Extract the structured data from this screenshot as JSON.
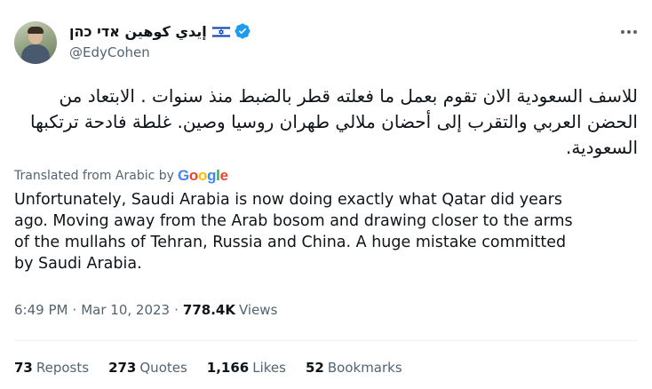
{
  "author": {
    "display_name": "إيدي كوهين אדי כהן",
    "handle": "@EdyCohen",
    "flag_icon": "israel-flag-icon",
    "verified_icon": "verified-badge-icon",
    "verified_color": "#1d9bf0"
  },
  "tweet": {
    "original_lines": [
      "للاسف السعودية الان تقوم بعمل ما فعلته قطر بالضبط منذ سنوات . الابتعاد من",
      "الحضن العربي والتقرب إلى أحضان ملالي طهران روسيا وصين. غلطة فادحة ترتكبها",
      "السعودية."
    ],
    "translated_label": "Translated from Arabic by",
    "translator": "Google",
    "translation_lines": [
      "Unfortunately, Saudi Arabia is now doing exactly what Qatar did years",
      "ago. Moving away from the Arab bosom and drawing closer to the arms",
      "of the mullahs of Tehran, Russia and China. A huge mistake committed",
      "by Saudi Arabia."
    ]
  },
  "meta": {
    "time": "6:49 PM",
    "separator": "·",
    "date": "Mar 10, 2023",
    "views_count": "778.4K",
    "views_label": "Views"
  },
  "stats": {
    "reposts_count": "73",
    "reposts_label": "Reposts",
    "quotes_count": "273",
    "quotes_label": "Quotes",
    "likes_count": "1,166",
    "likes_label": "Likes",
    "bookmarks_count": "52",
    "bookmarks_label": "Bookmarks"
  },
  "colors": {
    "text_primary": "#0f1419",
    "text_secondary": "#536471",
    "divider": "#eff3f4"
  }
}
